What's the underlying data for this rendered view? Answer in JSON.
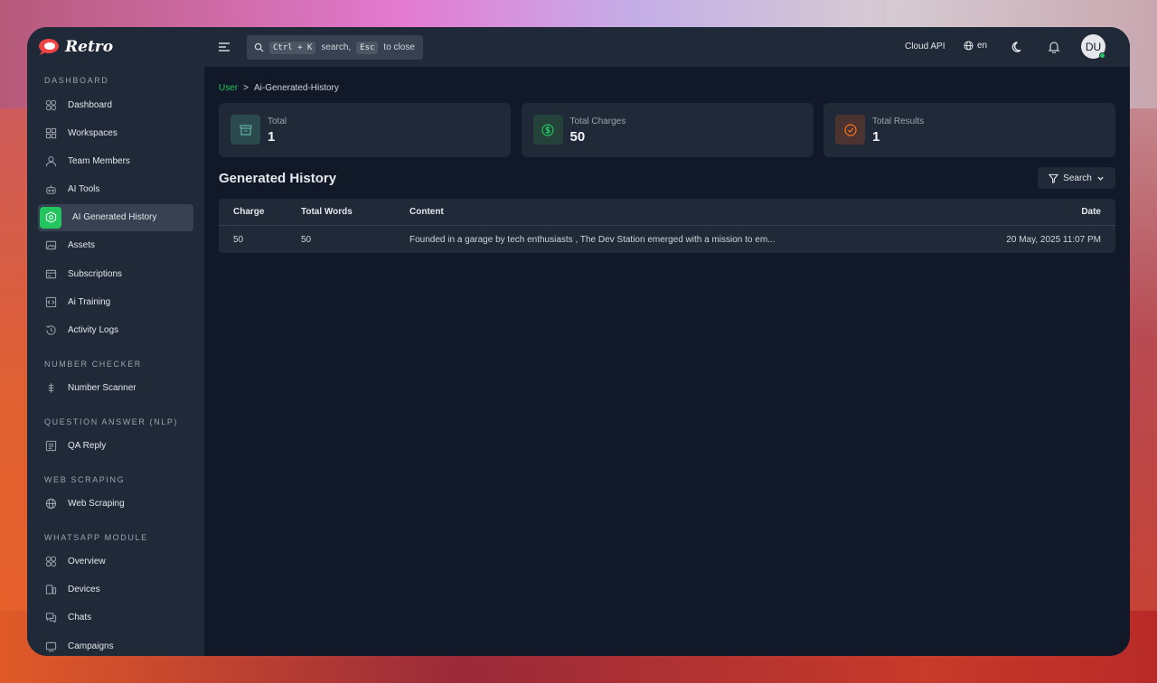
{
  "app": {
    "name": "Retro",
    "colors": {
      "accent": "#22c55e",
      "bg": "#111827",
      "panel": "#1f2937"
    }
  },
  "sidebar": {
    "sections": [
      {
        "title": "DASHBOARD",
        "items": [
          {
            "label": "Dashboard",
            "icon": "grid-circles-icon"
          },
          {
            "label": "Workspaces",
            "icon": "grid-squares-icon"
          },
          {
            "label": "Team Members",
            "icon": "user-icon"
          },
          {
            "label": "AI Tools",
            "icon": "robot-icon"
          },
          {
            "label": "AI Generated History",
            "icon": "ai-chip-icon",
            "active": true
          },
          {
            "label": "Assets",
            "icon": "image-icon"
          },
          {
            "label": "Subscriptions",
            "icon": "card-icon"
          },
          {
            "label": "Ai Training",
            "icon": "code-window-icon"
          },
          {
            "label": "Activity Logs",
            "icon": "history-icon"
          }
        ]
      },
      {
        "title": "NUMBER CHECKER",
        "items": [
          {
            "label": "Number Scanner",
            "icon": "scanner-icon"
          }
        ]
      },
      {
        "title": "QUESTION ANSWER (NLP)",
        "items": [
          {
            "label": "QA Reply",
            "icon": "document-icon"
          }
        ]
      },
      {
        "title": "WEB SCRAPING",
        "items": [
          {
            "label": "Web Scraping",
            "icon": "globe-icon"
          }
        ]
      },
      {
        "title": "WHATSAPP MODULE",
        "items": [
          {
            "label": "Overview",
            "icon": "grid-circles-icon"
          },
          {
            "label": "Devices",
            "icon": "devices-icon"
          },
          {
            "label": "Chats",
            "icon": "chat-icon"
          },
          {
            "label": "Campaigns",
            "icon": "campaign-icon"
          }
        ]
      }
    ]
  },
  "topbar": {
    "search_hint_1": "Ctrl + K",
    "search_text_1": "search,",
    "search_hint_2": "Esc",
    "search_text_2": "to close",
    "cloud_api": "Cloud API",
    "language": "en",
    "avatar_initials": "DU"
  },
  "breadcrumb": {
    "root": "User",
    "separator": ">",
    "current": "Ai-Generated-History"
  },
  "stats": [
    {
      "label": "Total",
      "value": "1",
      "icon": "archive-icon",
      "color": "#5eb3a6",
      "bg": "#2b4a4e"
    },
    {
      "label": "Total Charges",
      "value": "50",
      "icon": "dollar-icon",
      "color": "#22c55e",
      "bg": "#24423a"
    },
    {
      "label": "Total Results",
      "value": "1",
      "icon": "check-circle-icon",
      "color": "#f97316",
      "bg": "#4a3330"
    }
  ],
  "history": {
    "title": "Generated History",
    "search_label": "Search",
    "columns": [
      "Charge",
      "Total Words",
      "Content",
      "Date"
    ],
    "rows": [
      [
        "50",
        "50",
        "Founded in a garage by tech enthusiasts , The Dev Station emerged with a mission to em...",
        "20 May, 2025 11:07 PM"
      ]
    ]
  }
}
